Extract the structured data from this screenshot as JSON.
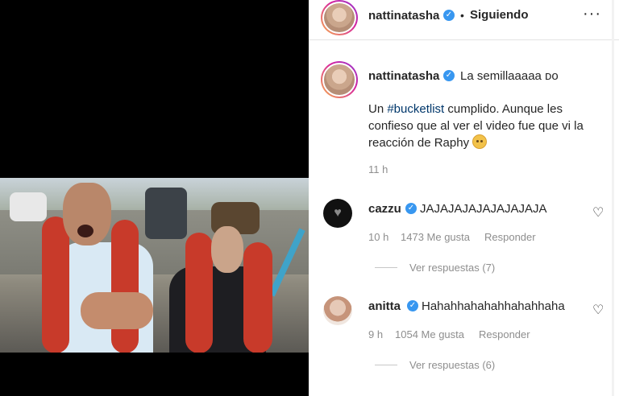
{
  "post": {
    "author": "nattinatasha",
    "follow_status": "Siguiendo",
    "more_icon": "more-icon",
    "verified_icon": "verified-icon"
  },
  "caption": {
    "author": "nattinatasha",
    "first_line": "La semillaaaaa ᴅᴏ",
    "pre_tag": "Un ",
    "hashtag": "#bucketlist",
    "body": " cumplido. Aunque les confieso que al ver el video fue que vi la reacción de Raphy ",
    "time": "11 h"
  },
  "comments": [
    {
      "author": "cazzu",
      "text": "JAJAJAJAJAJAJAJAJA",
      "time": "10 h",
      "likes": "1473 Me gusta",
      "reply": "Responder",
      "view_replies": "Ver respuestas (7)"
    },
    {
      "author": "anitta",
      "text": "Hahahhahahahhahahhaha",
      "time": "9 h",
      "likes": "1054 Me gusta",
      "reply": "Responder",
      "view_replies": "Ver respuestas (6)"
    }
  ],
  "colors": {
    "verified": "#3897f0",
    "hashtag": "#00376b",
    "muted": "#8e8e8e",
    "text": "#262626"
  }
}
